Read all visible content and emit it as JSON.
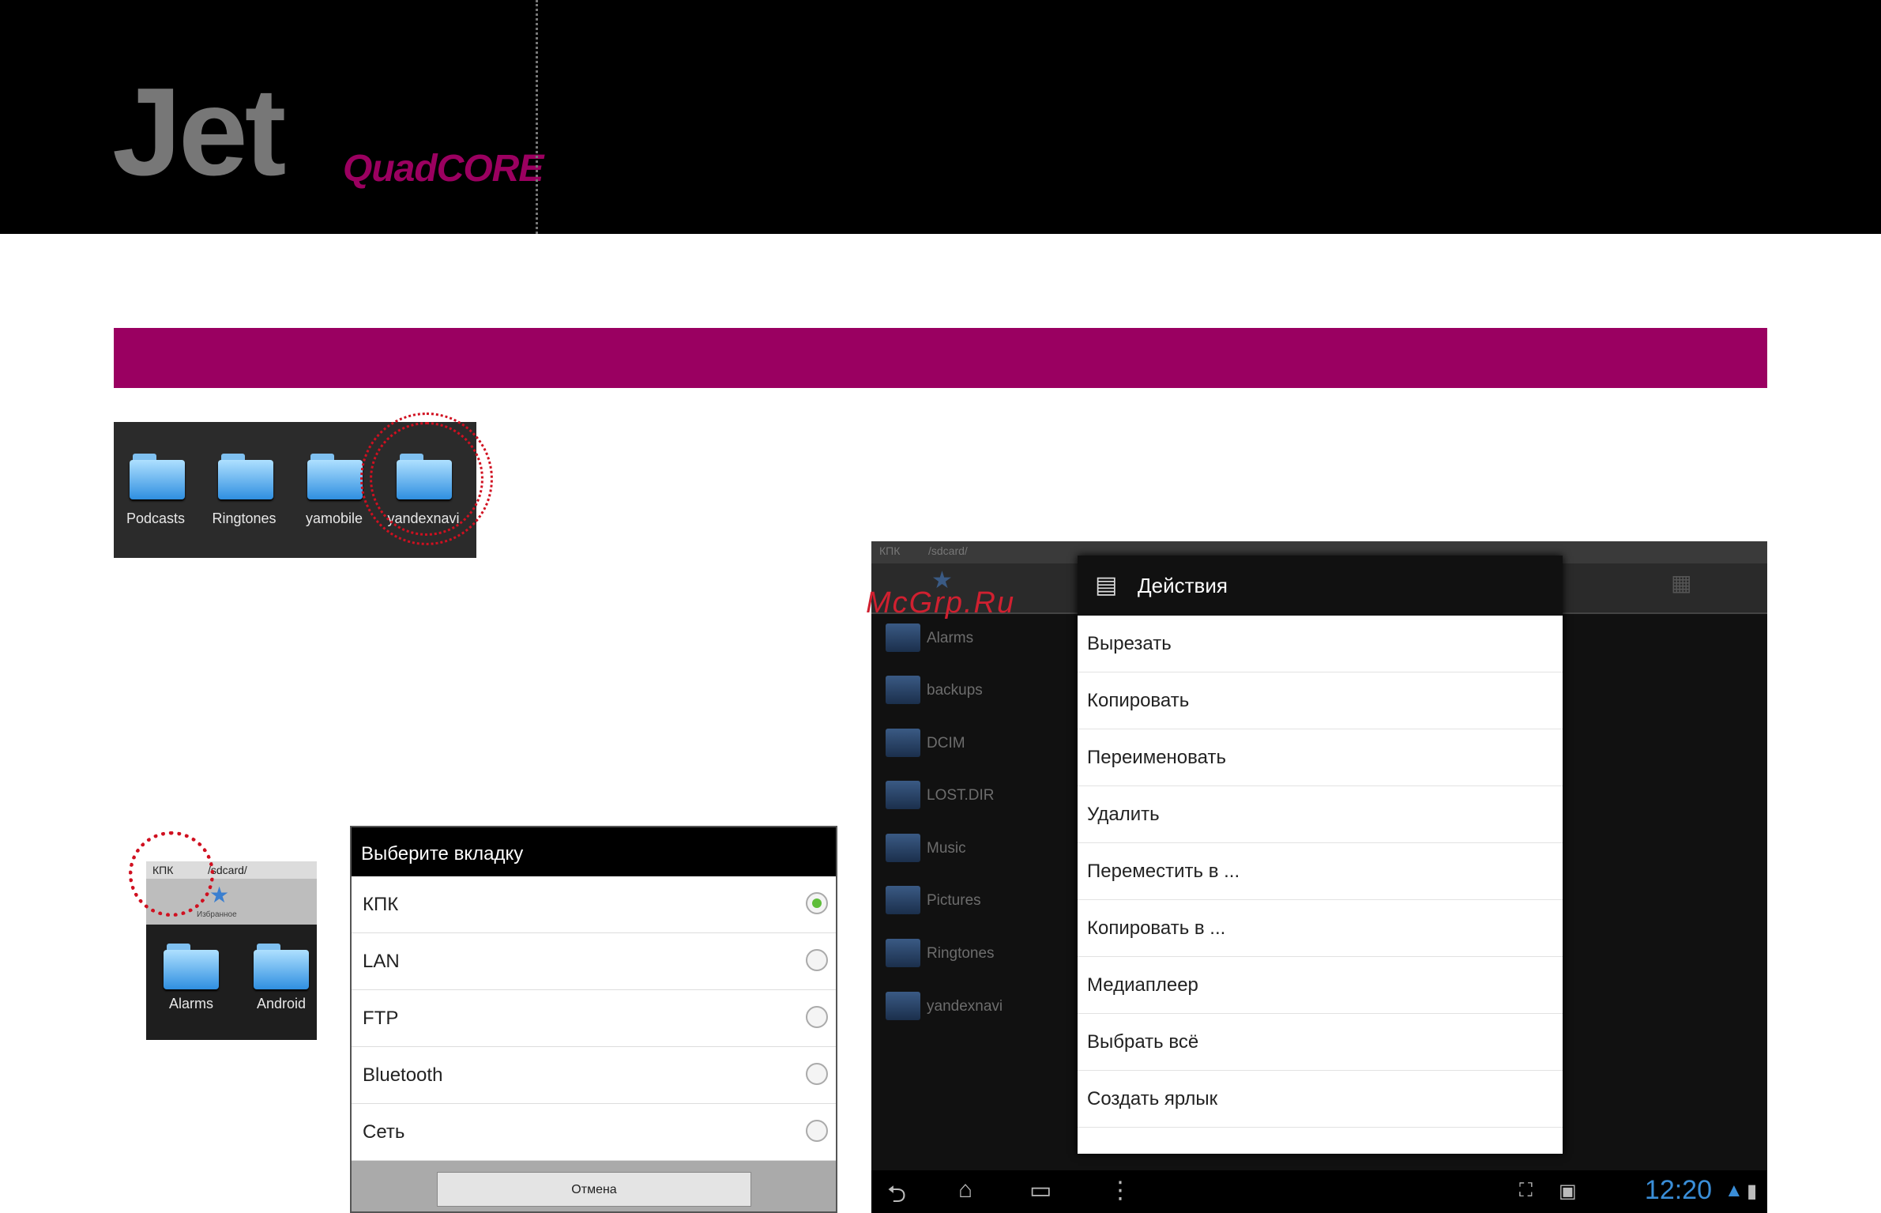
{
  "header": {
    "brand": "Jet",
    "brand_sub": "QuadCORE"
  },
  "folder_strip": {
    "folders": [
      "Podcasts",
      "Ringtones",
      "yamobile",
      "yandexnavi"
    ],
    "highlighted": "yandexnavi"
  },
  "mini_screenshot": {
    "tab_kpk": "КПК",
    "path": "/sdcard/",
    "favorites": "Избранное",
    "folders": [
      "Alarms",
      "Android"
    ]
  },
  "chooser": {
    "title": "Выберите вкладку",
    "options": [
      {
        "label": "КПК",
        "selected": true
      },
      {
        "label": "LAN",
        "selected": false
      },
      {
        "label": "FTP",
        "selected": false
      },
      {
        "label": "Bluetooth",
        "selected": false
      },
      {
        "label": "Сеть",
        "selected": false
      }
    ],
    "cancel": "Отмена"
  },
  "tablet": {
    "tab_kpk": "КПК",
    "path": "/sdcard/",
    "folders": [
      "Alarms",
      "backups",
      "DCIM",
      "LOST.DIR",
      "Music",
      "Pictures",
      "Ringtones",
      "yandexnavi"
    ],
    "time": "12:20",
    "watermark": "McGrp.Ru"
  },
  "actions": {
    "title": "Действия",
    "items": [
      "Вырезать",
      "Копировать",
      "Переименовать",
      "Удалить",
      "Переместить в ...",
      "Копировать в ...",
      "Медиаплеер",
      "Выбрать всё",
      "Создать ярлык"
    ]
  },
  "colors": {
    "accent": "#9a0061",
    "header_bg": "#000000",
    "highlight_ring": "#d01020",
    "clock_blue": "#3a8ed8"
  }
}
